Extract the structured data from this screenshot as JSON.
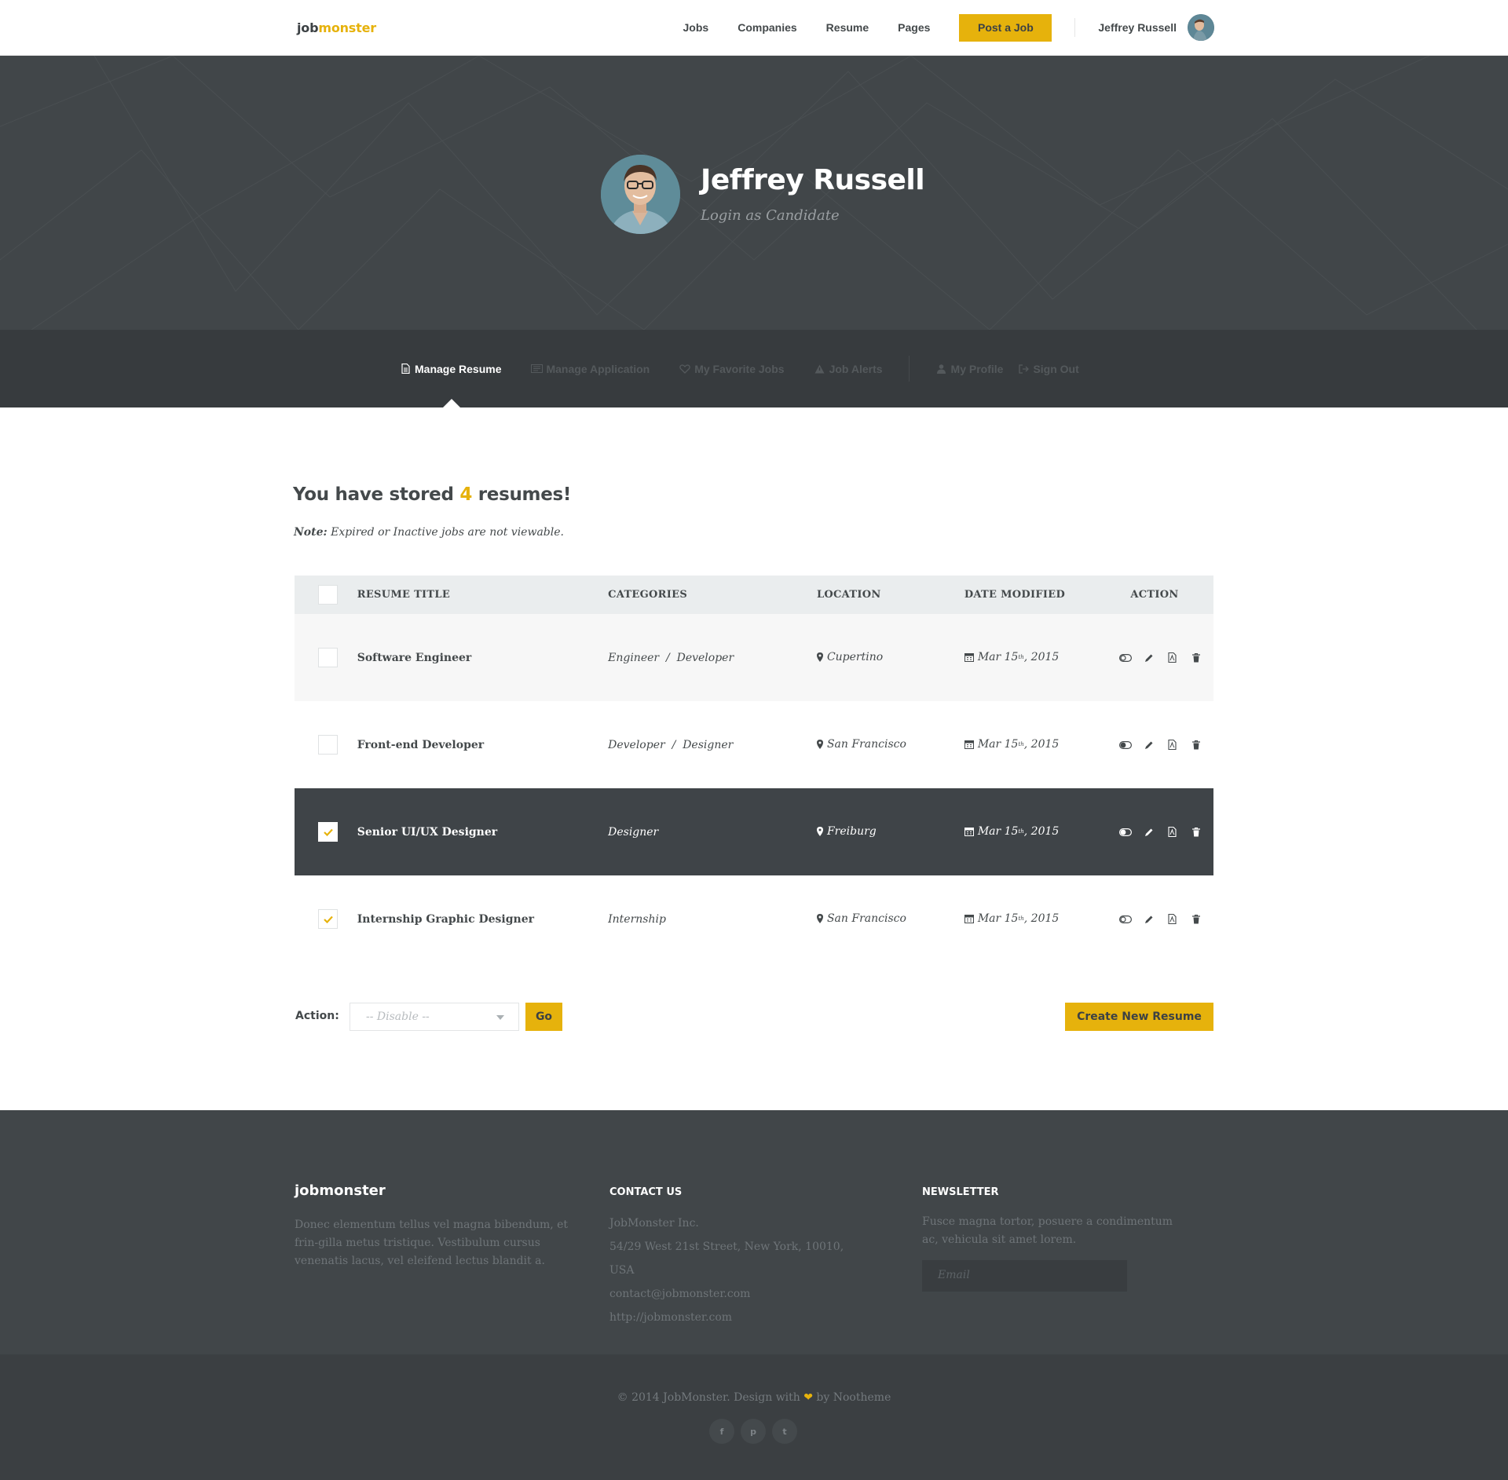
{
  "header": {
    "logo_left": "job",
    "logo_right": "monster",
    "nav": [
      "Jobs",
      "Companies",
      "Resume",
      "Pages"
    ],
    "post_job": "Post a Job",
    "user_name": "Jeffrey Russell"
  },
  "hero": {
    "name": "Jeffrey Russell",
    "subtitle": "Login as Candidate"
  },
  "tabs": [
    {
      "label": "Manage Resume",
      "icon": "document-icon",
      "active": true
    },
    {
      "label": "Manage Application",
      "icon": "newspaper-icon",
      "active": false
    },
    {
      "label": "My Favorite Jobs",
      "icon": "heart-icon",
      "active": false
    },
    {
      "label": "Job Alerts",
      "icon": "warning-icon",
      "active": false
    },
    {
      "label": "My Profile",
      "icon": "user-icon",
      "active": false
    },
    {
      "label": "Sign Out",
      "icon": "sign-out-icon",
      "active": false
    }
  ],
  "main": {
    "count_prefix": "You have stored ",
    "count": "4",
    "count_suffix": " resumes!",
    "note_label": "Note:",
    "note_text": " Expired or Inactive jobs are not viewable."
  },
  "table": {
    "headers": [
      "RESUME TITLE",
      "CATEGORIES",
      "LOCATION",
      "DATE MODIFIED",
      "ACTION"
    ],
    "rows": [
      {
        "title": "Software Engineer",
        "categories": "Engineer  /  Developer",
        "location": "Cupertino",
        "date_day": "Mar 15",
        "date_sup": "th",
        "date_year": ", 2015",
        "checked": false,
        "toggle_on": false
      },
      {
        "title": "Front-end Developer",
        "categories": "Developer  /  Designer",
        "location": "San Francisco",
        "date_day": "Mar 15",
        "date_sup": "th",
        "date_year": ", 2015",
        "checked": false,
        "toggle_on": true
      },
      {
        "title": "Senior UI/UX Designer",
        "categories": "Designer",
        "location": "Freiburg",
        "date_day": "Mar 15",
        "date_sup": "th",
        "date_year": ", 2015",
        "checked": true,
        "toggle_on": true
      },
      {
        "title": "Internship Graphic Designer",
        "categories": "Internship",
        "location": "San Francisco",
        "date_day": "Mar 15",
        "date_sup": "th",
        "date_year": ", 2015",
        "checked": true,
        "toggle_on": false
      }
    ]
  },
  "actions": {
    "label": "Action:",
    "select_value": "-- Disable --",
    "go": "Go",
    "create": "Create New Resume"
  },
  "footer": {
    "brand": "jobmonster",
    "about": "Donec elementum tellus vel magna bibendum, et frin-gilla metus tristique. Vestibulum cursus venenatis lacus, vel eleifend lectus blandit a.",
    "contact_heading": "CONTACT US",
    "contact_lines": [
      "JobMonster Inc.",
      "54/29 West 21st Street, New York, 10010, USA",
      "contact@jobmonster.com",
      "http://jobmonster.com"
    ],
    "newsletter_heading": "NEWSLETTER",
    "newsletter_text": "Fusce magna tortor, posuere a condimentum ac, vehicula sit amet lorem.",
    "email_placeholder": "Email",
    "copyright_before": "© 2014 JobMonster. Design with ",
    "copyright_after": " by Nootheme",
    "socials": [
      "f",
      "p",
      "t"
    ]
  },
  "colors": {
    "accent": "#e6b20c",
    "dark": "#414649",
    "tabs_bg": "#373b3e"
  }
}
